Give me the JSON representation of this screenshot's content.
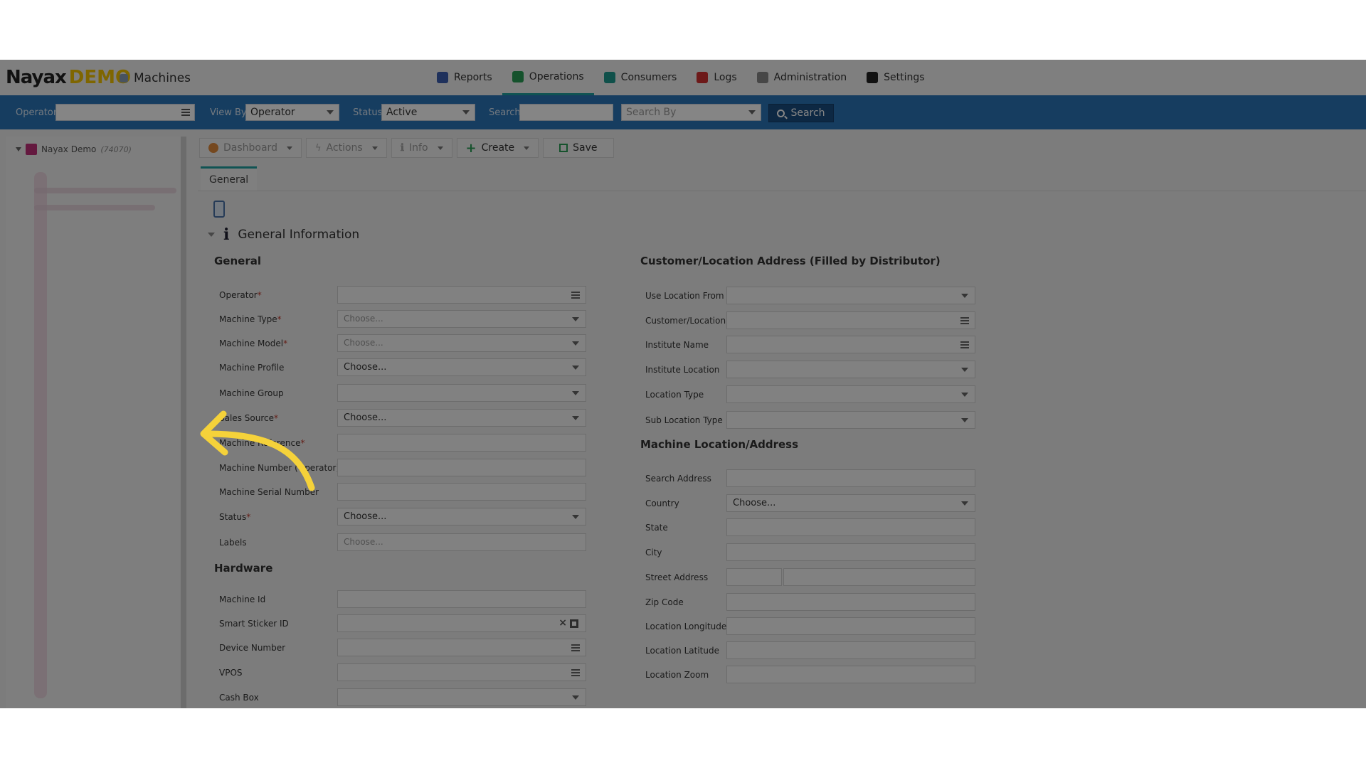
{
  "brand": {
    "name": "Nayax",
    "suffix": "DEMO"
  },
  "breadcrumb": "Machines",
  "nav": {
    "tabs": [
      {
        "label": "Reports",
        "icon": "reports-icon",
        "color": "#3d5fb0"
      },
      {
        "label": "Operations",
        "icon": "operations-icon",
        "color": "#2a9d55",
        "active": true
      },
      {
        "label": "Consumers",
        "icon": "consumers-icon",
        "color": "#1e9a8e"
      },
      {
        "label": "Logs",
        "icon": "logs-icon",
        "color": "#d23131"
      },
      {
        "label": "Administration",
        "icon": "administration-icon",
        "color": "#888888"
      },
      {
        "label": "Settings",
        "icon": "settings-icon",
        "color": "#222222"
      }
    ]
  },
  "filters": {
    "operator_label": "Operator",
    "operator_value": "",
    "viewby_label": "View By",
    "viewby_value": "Operator",
    "status_label": "Status",
    "status_value": "Active",
    "search_label": "Search",
    "search_value": "",
    "searchby_placeholder": "Search By",
    "search_button": "Search"
  },
  "tree": {
    "root_label": "Nayax Demo",
    "root_count": "(74070)"
  },
  "toolbar": {
    "dashboard": "Dashboard",
    "actions": "Actions",
    "info": "Info",
    "create": "Create",
    "save": "Save"
  },
  "tabs": {
    "general": "General"
  },
  "section": {
    "title": "General Information"
  },
  "groups": {
    "general": "General",
    "customer_location": "Customer/Location Address (Filled by Distributor)",
    "hardware": "Hardware",
    "machine_location": "Machine Location/Address"
  },
  "form": {
    "operator": {
      "label": "Operator",
      "required": "*",
      "value": ""
    },
    "machine_type": {
      "label": "Machine Type",
      "required": "*",
      "value": "Choose..."
    },
    "machine_model": {
      "label": "Machine Model",
      "required": "*",
      "value": "Choose..."
    },
    "machine_profile": {
      "label": "Machine Profile",
      "value": "Choose..."
    },
    "machine_group": {
      "label": "Machine Group",
      "value": ""
    },
    "sales_source": {
      "label": "Sales Source",
      "required": "*",
      "value": "Choose..."
    },
    "machine_reference": {
      "label": "Machine Reference",
      "required": "*",
      "value": ""
    },
    "machine_number": {
      "label": "Machine Number (Operator)",
      "value": ""
    },
    "machine_serial": {
      "label": "Machine Serial Number",
      "value": ""
    },
    "status": {
      "label": "Status",
      "required": "*",
      "value": "Choose..."
    },
    "labels": {
      "label": "Labels",
      "value": "Choose..."
    },
    "machine_id": {
      "label": "Machine Id",
      "value": ""
    },
    "smart_sticker_id": {
      "label": "Smart Sticker ID",
      "value": ""
    },
    "device_number": {
      "label": "Device Number",
      "value": ""
    },
    "vpos": {
      "label": "VPOS",
      "value": ""
    },
    "cash_box": {
      "label": "Cash Box",
      "value": ""
    },
    "use_location_from": {
      "label": "Use Location From",
      "value": ""
    },
    "customer_location": {
      "label": "Customer/Location",
      "value": ""
    },
    "institute_name": {
      "label": "Institute Name",
      "value": ""
    },
    "institute_location": {
      "label": "Institute Location",
      "value": ""
    },
    "location_type": {
      "label": "Location Type",
      "value": ""
    },
    "sub_location_type": {
      "label": "Sub Location Type",
      "value": ""
    },
    "search_address": {
      "label": "Search Address",
      "value": ""
    },
    "country": {
      "label": "Country",
      "value": "Choose..."
    },
    "state": {
      "label": "State",
      "value": ""
    },
    "city": {
      "label": "City",
      "value": ""
    },
    "street_address": {
      "label": "Street Address",
      "value": ""
    },
    "zip_code": {
      "label": "Zip Code",
      "value": ""
    },
    "location_longitude": {
      "label": "Location Longitude",
      "value": ""
    },
    "location_latitude": {
      "label": "Location Latitude",
      "value": ""
    },
    "location_zoom": {
      "label": "Location Zoom",
      "value": ""
    }
  },
  "annotation": {
    "arrow_color": "#f5d23a"
  }
}
